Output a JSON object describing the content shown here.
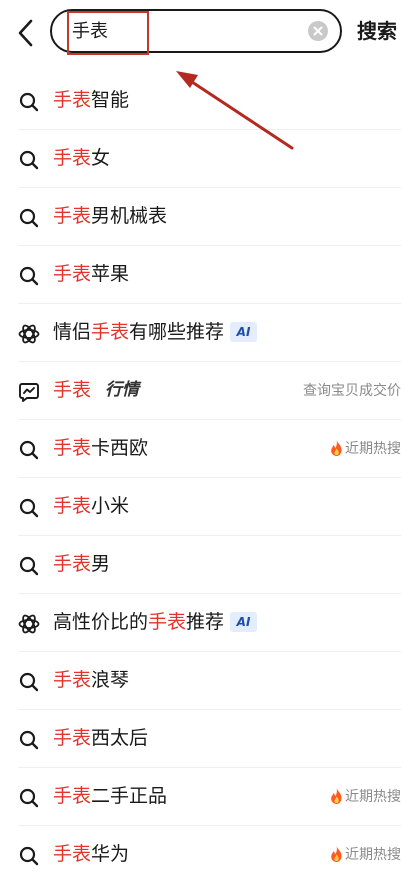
{
  "search": {
    "value": "手表",
    "submit_label": "搜索"
  },
  "suggestions": [
    {
      "type": "search",
      "pre": "",
      "highlight": "手表",
      "post": "智能"
    },
    {
      "type": "search",
      "pre": "",
      "highlight": "手表",
      "post": "女"
    },
    {
      "type": "search",
      "pre": "",
      "highlight": "手表",
      "post": "男机械表"
    },
    {
      "type": "search",
      "pre": "",
      "highlight": "手表",
      "post": "苹果"
    },
    {
      "type": "ai",
      "pre": "情侣",
      "highlight": "手表",
      "post": "有哪些推荐",
      "badge": "AI"
    },
    {
      "type": "market",
      "pre": "",
      "highlight": "手表",
      "post": "",
      "badge": "行情",
      "right": "查询宝贝成交价"
    },
    {
      "type": "search",
      "pre": "",
      "highlight": "手表",
      "post": "卡西欧",
      "right": "近期热搜"
    },
    {
      "type": "search",
      "pre": "",
      "highlight": "手表",
      "post": "小米"
    },
    {
      "type": "search",
      "pre": "",
      "highlight": "手表",
      "post": "男"
    },
    {
      "type": "ai",
      "pre": "高性价比的",
      "highlight": "手表",
      "post": "推荐",
      "badge": "AI"
    },
    {
      "type": "search",
      "pre": "",
      "highlight": "手表",
      "post": "浪琴"
    },
    {
      "type": "search",
      "pre": "",
      "highlight": "手表",
      "post": "西太后"
    },
    {
      "type": "search",
      "pre": "",
      "highlight": "手表",
      "post": "二手正品",
      "right": "近期热搜"
    },
    {
      "type": "search",
      "pre": "",
      "highlight": "手表",
      "post": "华为",
      "right": "近期热搜"
    }
  ],
  "colors": {
    "highlight": "#e2342d",
    "annotation": "#c0392b",
    "hot_flame": "#ff5a1f"
  }
}
